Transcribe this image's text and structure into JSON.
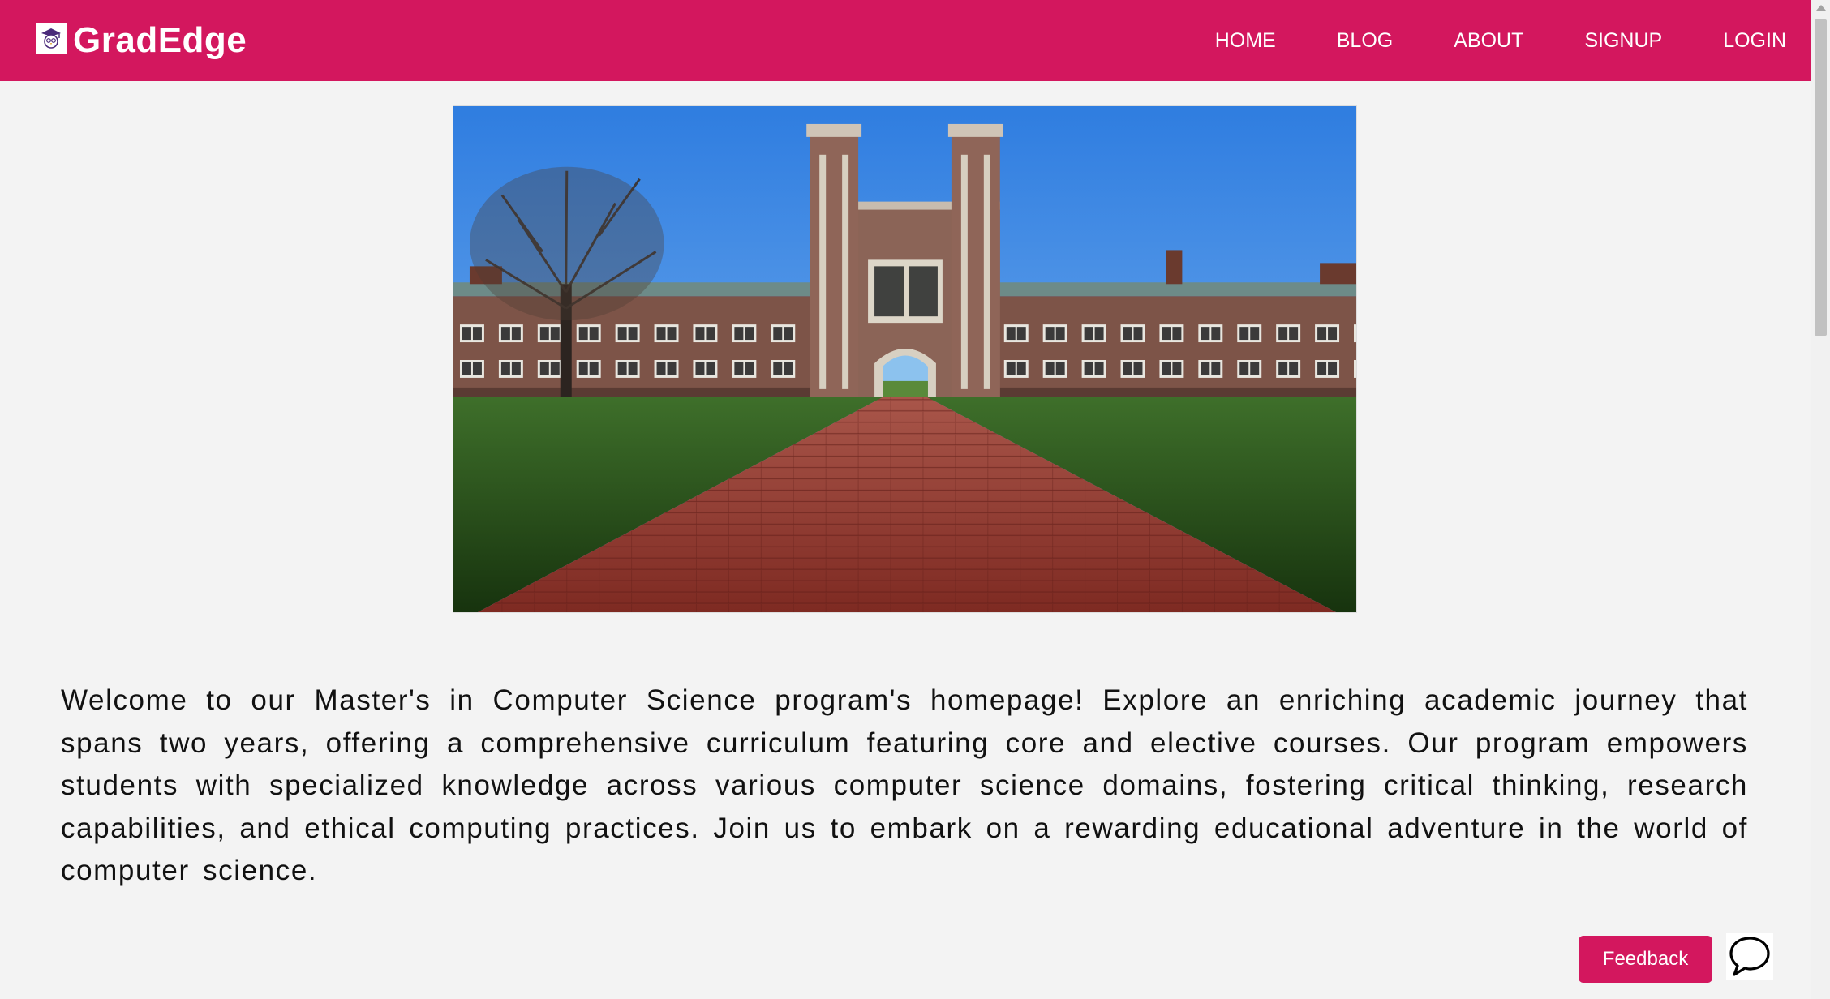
{
  "brand": {
    "name": "GradEdge",
    "logo_icon": "graduate-owl-icon"
  },
  "nav": {
    "items": [
      {
        "label": "HOME"
      },
      {
        "label": "BLOG"
      },
      {
        "label": "ABOUT"
      },
      {
        "label": "SIGNUP"
      },
      {
        "label": "LOGIN"
      }
    ]
  },
  "hero": {
    "image": "campus-building-photo"
  },
  "intro": {
    "text": "Welcome to our Master's in Computer Science program's homepage! Explore an enriching academic journey that spans two years, offering a comprehensive curriculum featuring core and elective courses. Our program empowers students with specialized knowledge across various computer science domains, fostering critical thinking, research capabilities, and ethical computing practices. Join us to embark on a rewarding educational adventure in the world of computer science."
  },
  "actions": {
    "feedback_label": "Feedback",
    "chat_icon": "chat-bubble-icon"
  },
  "colors": {
    "brand": "#d3175e",
    "background": "#f3f3f3",
    "text": "#111111"
  }
}
